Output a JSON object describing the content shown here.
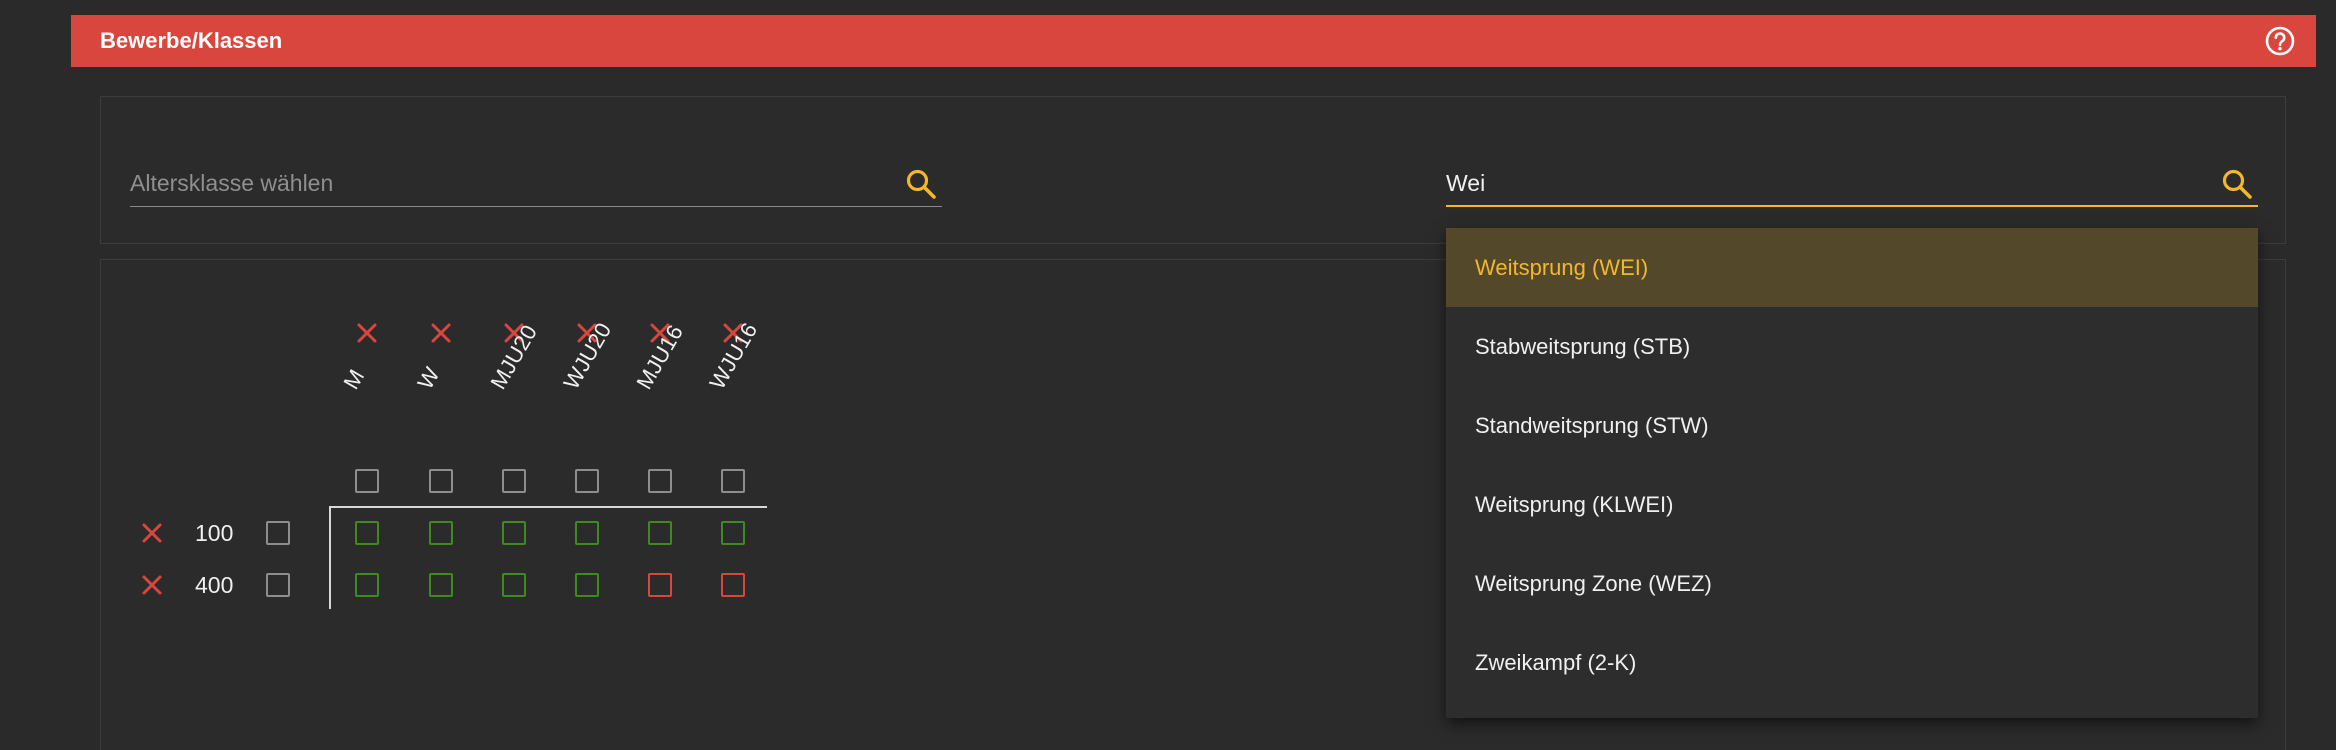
{
  "header": {
    "title": "Bewerbe/Klassen"
  },
  "search": {
    "age_class_placeholder": "Altersklasse wählen",
    "discipline_value": "Wei"
  },
  "matrix": {
    "columns": [
      "M",
      "W",
      "MJU20",
      "WJU20",
      "MJU16",
      "WJU16"
    ],
    "rows": [
      {
        "label": "100",
        "cells": [
          "valid",
          "valid",
          "valid",
          "valid",
          "valid",
          "valid"
        ]
      },
      {
        "label": "400",
        "cells": [
          "valid",
          "valid",
          "valid",
          "valid",
          "invalid",
          "invalid"
        ]
      }
    ]
  },
  "dropdown": {
    "items": [
      {
        "label": "Weitsprung (WEI)",
        "highlighted": true
      },
      {
        "label": "Stabweitsprung (STB)"
      },
      {
        "label": "Standweitsprung (STW)"
      },
      {
        "label": "Weitsprung (KLWEI)"
      },
      {
        "label": "Weitsprung Zone (WEZ)"
      },
      {
        "label": "Zweikampf (2-K)"
      }
    ]
  },
  "colors": {
    "header": "#d9463e",
    "accent": "#f2b82a",
    "valid": "#3e8a1c",
    "invalid": "#d9463e",
    "background": "#2a2a2a"
  },
  "icons": {
    "help": "help-circle-icon",
    "search": "search-icon",
    "remove": "close-icon"
  }
}
